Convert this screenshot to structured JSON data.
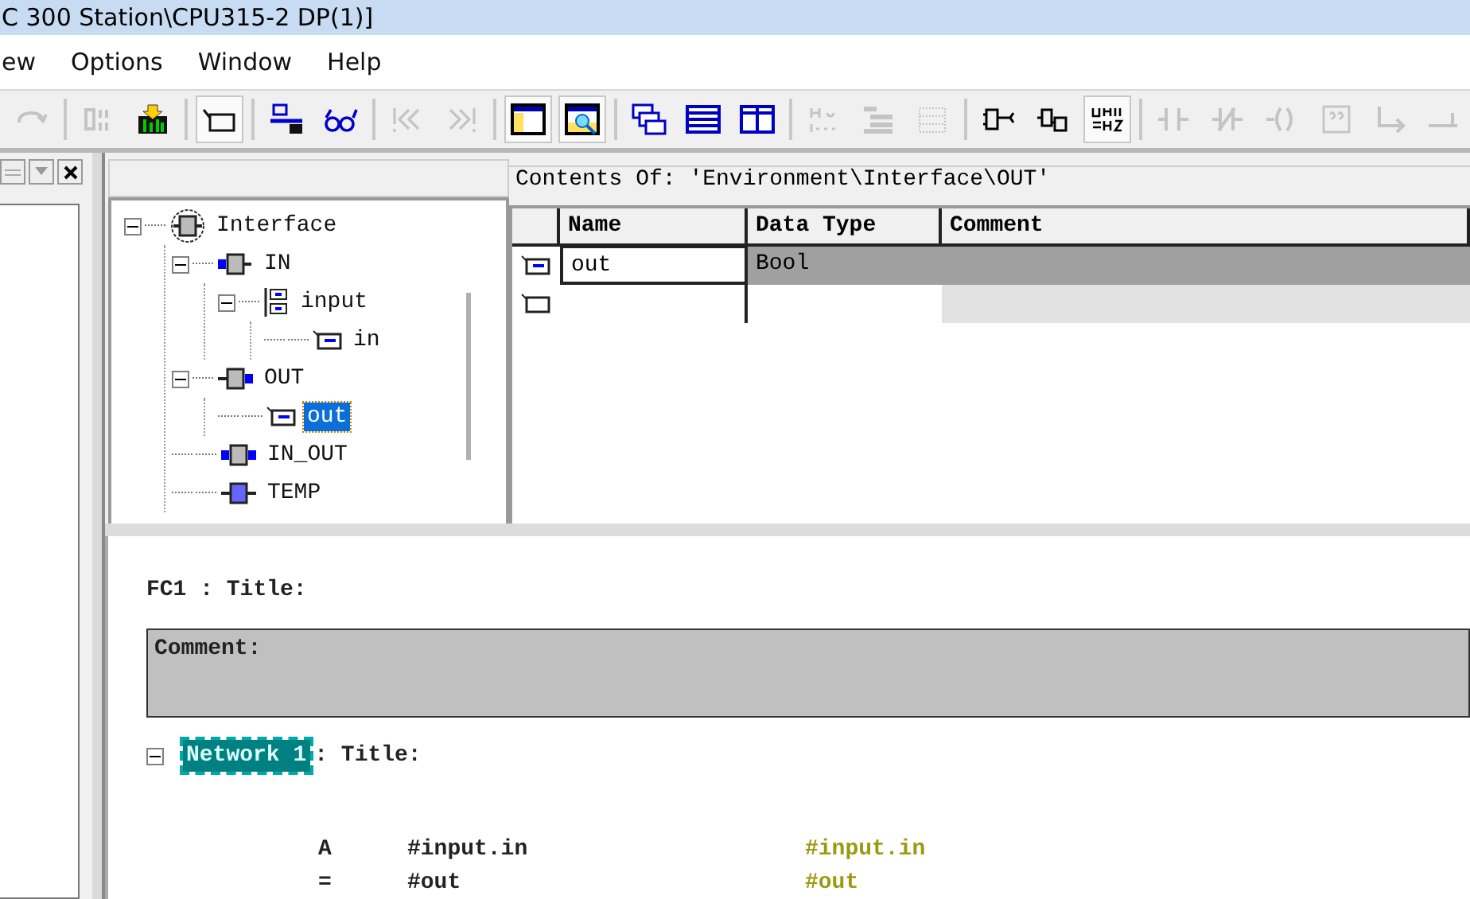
{
  "window": {
    "title": "C 300 Station\\CPU315-2 DP(1)]"
  },
  "menu": [
    {
      "label": "ew"
    },
    {
      "label": "Options"
    },
    {
      "label": "Window"
    },
    {
      "label": "Help"
    }
  ],
  "toolbar_groups": [
    {
      "buttons": [
        {
          "kind": "redo",
          "disabled": true,
          "pressed": false
        }
      ]
    },
    {
      "buttons": [
        {
          "kind": "io",
          "disabled": true,
          "pressed": false
        },
        {
          "kind": "download",
          "disabled": false,
          "pressed": false
        }
      ]
    },
    {
      "buttons": [
        {
          "kind": "tag",
          "disabled": false,
          "pressed": true
        }
      ]
    },
    {
      "buttons": [
        {
          "kind": "network",
          "disabled": false,
          "pressed": false
        },
        {
          "kind": "glasses",
          "disabled": false,
          "pressed": false
        }
      ]
    },
    {
      "buttons": [
        {
          "kind": "jump-start",
          "disabled": true,
          "pressed": false
        },
        {
          "kind": "jump-end",
          "disabled": true,
          "pressed": false
        }
      ]
    },
    {
      "buttons": [
        {
          "kind": "panel-left",
          "disabled": false,
          "pressed": true
        },
        {
          "kind": "panel-search",
          "disabled": false,
          "pressed": true
        }
      ]
    },
    {
      "buttons": [
        {
          "kind": "windows",
          "disabled": false,
          "pressed": false
        },
        {
          "kind": "rows",
          "disabled": false,
          "pressed": false
        },
        {
          "kind": "columns",
          "disabled": false,
          "pressed": false
        }
      ]
    },
    {
      "buttons": [
        {
          "kind": "ladder",
          "disabled": true,
          "pressed": false
        },
        {
          "kind": "list",
          "disabled": true,
          "pressed": false
        },
        {
          "kind": "grid",
          "disabled": true,
          "pressed": false
        }
      ]
    },
    {
      "buttons": [
        {
          "kind": "block-wire",
          "disabled": false,
          "pressed": false
        },
        {
          "kind": "block",
          "disabled": false,
          "pressed": false
        },
        {
          "kind": "stl",
          "disabled": false,
          "pressed": true
        }
      ]
    },
    {
      "buttons": [
        {
          "kind": "contact-no",
          "disabled": true,
          "pressed": false
        },
        {
          "kind": "contact-nc",
          "disabled": true,
          "pressed": false
        },
        {
          "kind": "coil",
          "disabled": true,
          "pressed": false
        },
        {
          "kind": "empty-box",
          "disabled": true,
          "pressed": false
        },
        {
          "kind": "branch",
          "disabled": true,
          "pressed": false
        },
        {
          "kind": "branch-close",
          "disabled": true,
          "pressed": false
        }
      ]
    }
  ],
  "tree": [
    {
      "label": "Interface",
      "kind": "interface",
      "expanded": true,
      "selected": false,
      "children": [
        {
          "label": "IN",
          "kind": "section-in",
          "expanded": true,
          "selected": false,
          "children": [
            {
              "label": "input",
              "kind": "struct",
              "expanded": true,
              "selected": false,
              "children": [
                {
                  "label": "in",
                  "kind": "variable",
                  "selected": false
                }
              ]
            }
          ]
        },
        {
          "label": "OUT",
          "kind": "section-out",
          "expanded": true,
          "selected": false,
          "children": [
            {
              "label": "out",
              "kind": "variable",
              "selected": true
            }
          ]
        },
        {
          "label": "IN_OUT",
          "kind": "section-inout",
          "selected": false
        },
        {
          "label": "TEMP",
          "kind": "section-temp",
          "selected": false
        }
      ]
    }
  ],
  "contents": {
    "title": "Contents Of: 'Environment\\Interface\\OUT'",
    "columns": [
      "Name",
      "Data Type",
      "Comment"
    ],
    "rows": [
      {
        "name": "out",
        "data_type": "Bool",
        "selected": true,
        "kind": "variable"
      },
      {
        "kind": "new"
      }
    ]
  },
  "block": {
    "title": "FC1 : Title:",
    "comment_label": "Comment:",
    "network": {
      "label": "Network 1",
      "title": ": Title:",
      "expanded": true,
      "statements": [
        {
          "op": "A",
          "operand": "#input.in",
          "annotation": "#input.in"
        },
        {
          "op": "=",
          "operand": "#out",
          "annotation": "#out"
        }
      ]
    }
  }
}
